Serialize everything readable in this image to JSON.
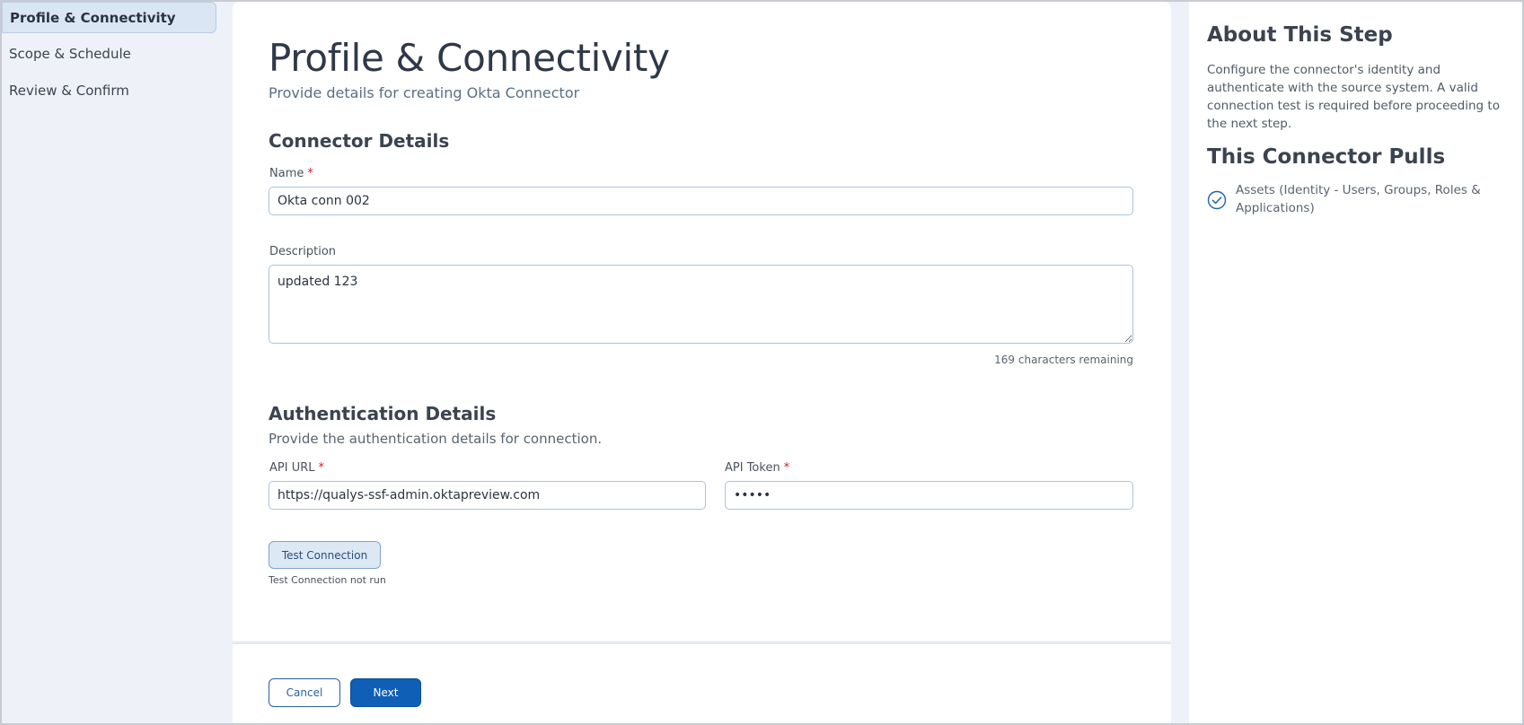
{
  "sidebar": {
    "items": [
      {
        "label": "Profile & Connectivity",
        "active": true
      },
      {
        "label": "Scope & Schedule",
        "active": false
      },
      {
        "label": "Review & Confirm",
        "active": false
      }
    ]
  },
  "main": {
    "title": "Profile & Connectivity",
    "subtitle": "Provide details for creating Okta Connector",
    "connector_details": {
      "heading": "Connector Details",
      "name_label": "Name",
      "name_value": "Okta conn 002",
      "description_label": "Description",
      "description_value": "updated 123",
      "chars_remaining": "169 characters remaining"
    },
    "auth_details": {
      "heading": "Authentication Details",
      "description": "Provide the authentication details for connection.",
      "api_url_label": "API URL",
      "api_url_value": "https://qualys-ssf-admin.oktapreview.com",
      "api_token_label": "API Token",
      "api_token_value": "•••••",
      "required_mark": "*"
    },
    "test_connection": {
      "button_label": "Test Connection",
      "status": "Test Connection not run"
    }
  },
  "footer": {
    "cancel_label": "Cancel",
    "next_label": "Next"
  },
  "info_panel": {
    "about_heading": "About This Step",
    "about_text": "Configure the connector's identity and authenticate with the source system. A valid connection test is required before proceeding to the next step.",
    "pulls_heading": "This Connector Pulls",
    "pulls_items": [
      "Assets (Identity - Users, Groups, Roles & Applications)"
    ]
  },
  "colors": {
    "primary": "#0f5fb7",
    "required": "#d3202b",
    "sidebar_active_bg": "#dbe6f4",
    "input_border": "#aac2e0"
  },
  "icons": {
    "pull_item": "check-circle-icon"
  }
}
